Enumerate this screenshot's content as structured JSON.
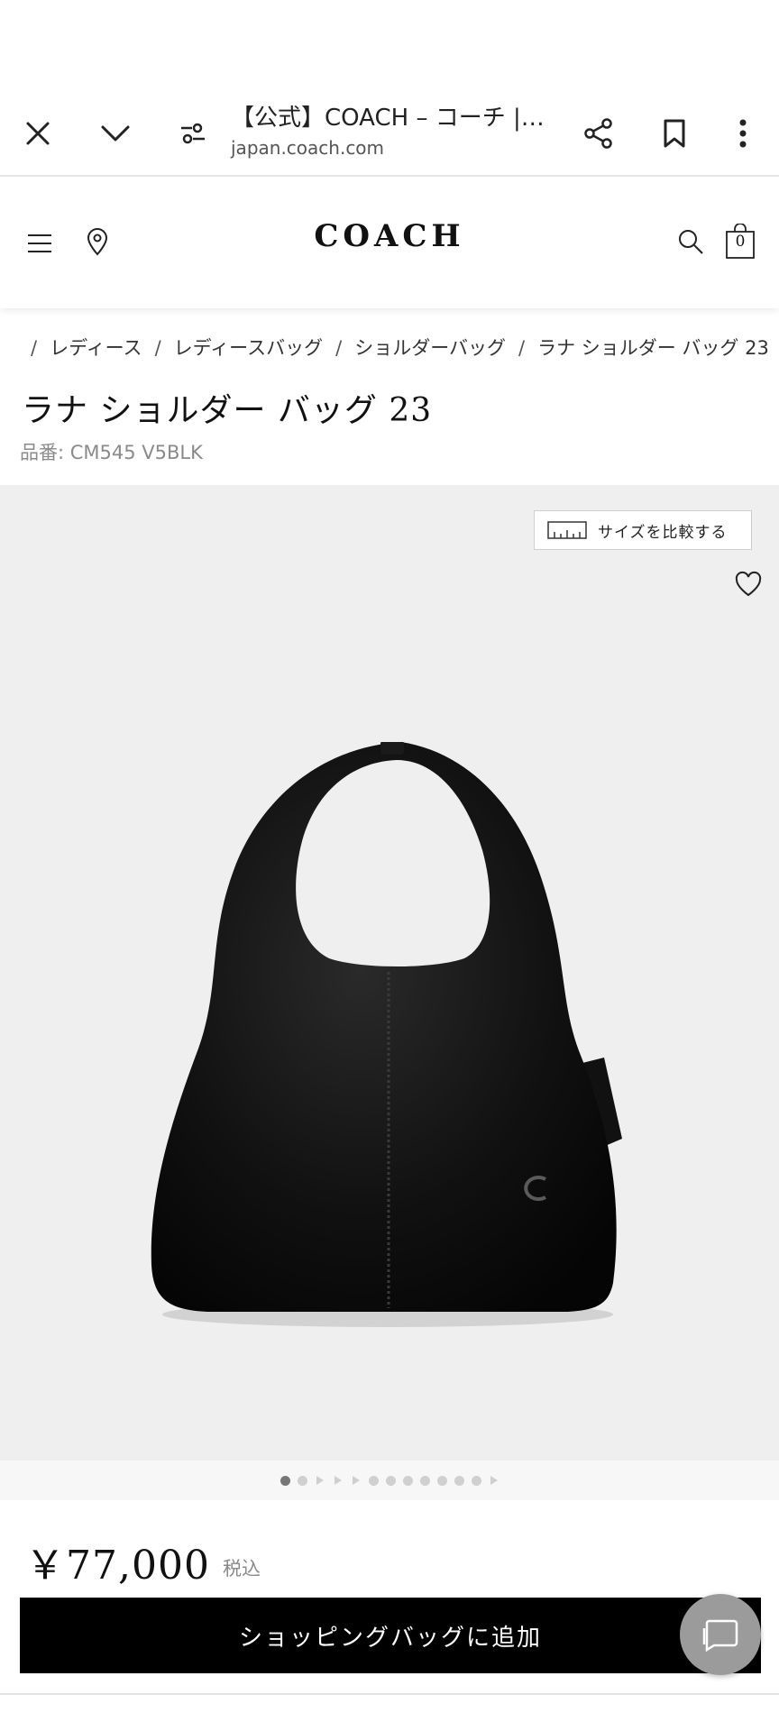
{
  "browser": {
    "title": "【公式】COACH – コーチ |…",
    "url": "japan.coach.com"
  },
  "header": {
    "logo": "COACH",
    "bag_count": "0"
  },
  "breadcrumb": {
    "items": [
      "レディース",
      "レディースバッグ",
      "ショルダーバッグ",
      "ラナ ショルダー バッグ 23"
    ]
  },
  "product": {
    "title": "ラナ ショルダー バッグ 23",
    "sku": "品番: CM545 V5BLK",
    "price": "￥77,000",
    "tax_note": "税込",
    "compare_label": "サイズを比較する",
    "add_to_bag_label": "ショッピングバッグに追加",
    "image_count": 13,
    "active_image_index": 0
  }
}
